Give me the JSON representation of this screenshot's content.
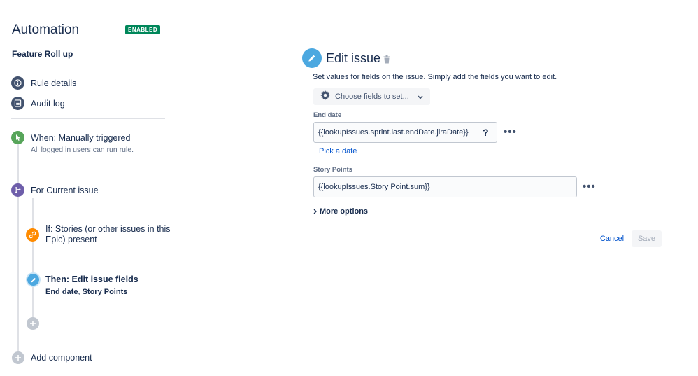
{
  "header": {
    "title": "Automation",
    "status": "ENABLED",
    "rule_name": "Feature Roll up"
  },
  "menu": {
    "rule_details": "Rule details",
    "audit_log": "Audit log"
  },
  "rule_flow": {
    "trigger": {
      "title": "When: Manually triggered",
      "subtitle": "All logged in users can run rule."
    },
    "branch": {
      "title": "For Current issue"
    },
    "condition": {
      "line1": "If: Stories (or other issues in this",
      "line2": "Epic) present"
    },
    "action": {
      "title": "Then: Edit issue fields",
      "fields_a": "End date",
      "separator": ", ",
      "fields_b": "Story Points"
    },
    "add_component": "Add component"
  },
  "panel": {
    "title": "Edit issue",
    "description": "Set values for fields on the issue. Simply add the fields you want to edit.",
    "choose_fields": "Choose fields to set...",
    "end_date": {
      "label": "End date",
      "value": "{{lookupIssues.sprint.last.endDate.jiraDate}}",
      "help": "?",
      "pick_link": "Pick a date"
    },
    "story_points": {
      "label": "Story Points",
      "value": "{{lookupIssues.Story Point.sum}}"
    },
    "more_options": "More options",
    "more_dots": "•••",
    "cancel": "Cancel",
    "save": "Save"
  },
  "colors": {
    "enabled": "#00875a",
    "trigger": "#57a55a",
    "branch": "#6e5eaa",
    "condition": "#ff8b00",
    "action": "#4ca8e0",
    "neutral": "#42526e",
    "link": "#0052cc"
  },
  "icons": {
    "rule_details": "info-icon",
    "audit_log": "list-icon",
    "trigger": "cursor-icon",
    "branch": "branch-icon",
    "condition": "link-icon",
    "action": "pencil-icon",
    "add": "plus-icon",
    "delete": "trash-icon",
    "settings": "gear-icon"
  }
}
